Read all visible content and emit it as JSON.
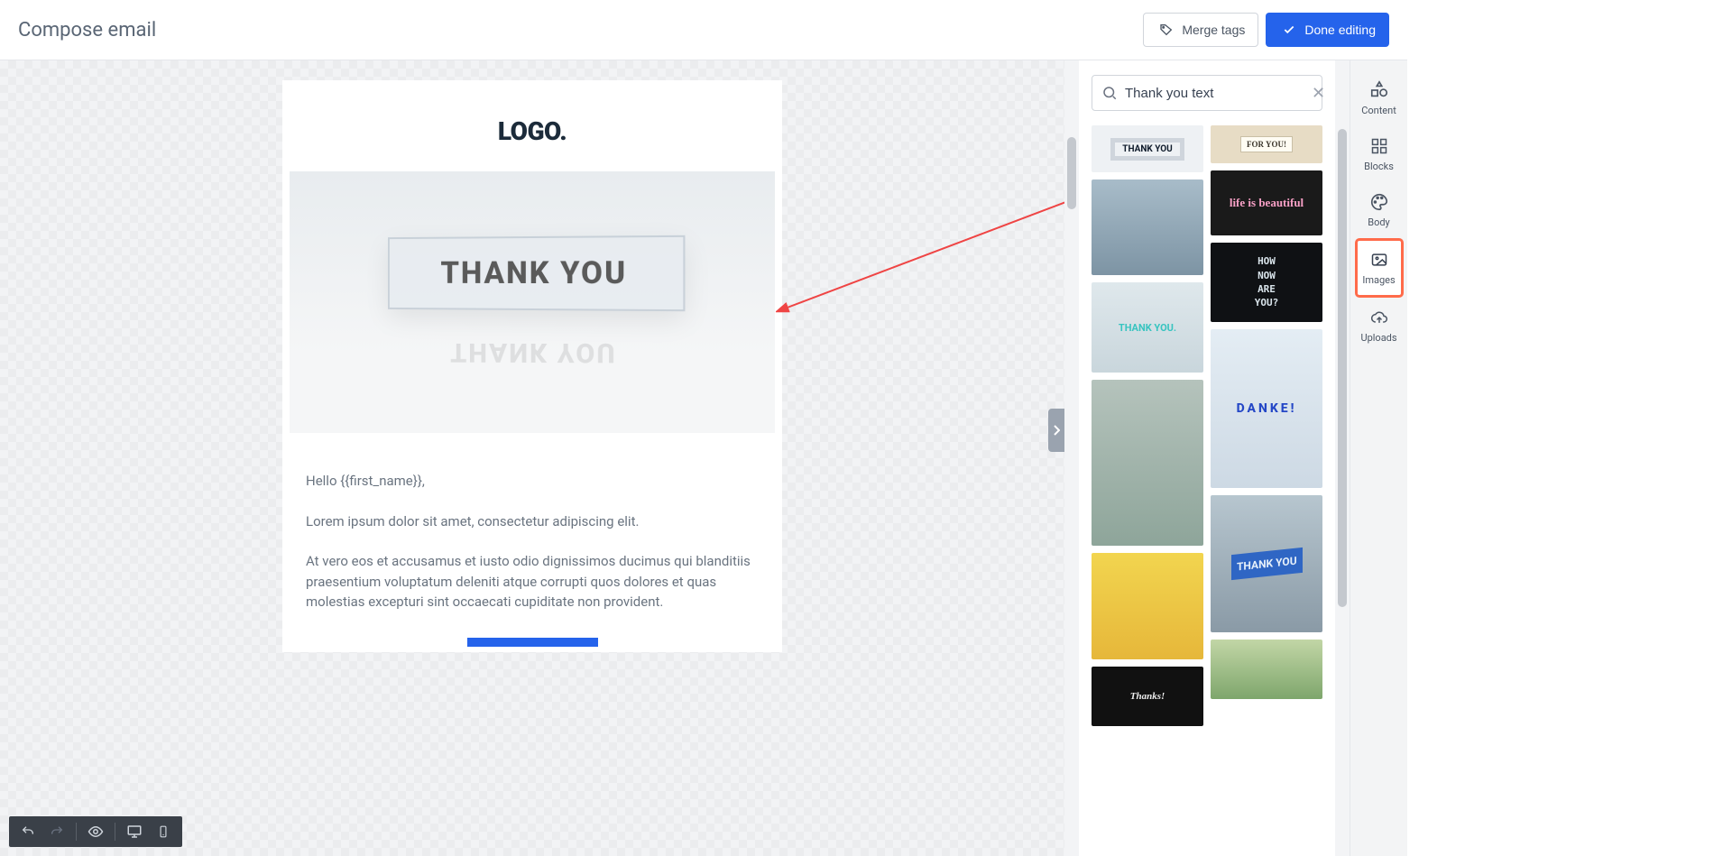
{
  "header": {
    "title": "Compose email",
    "merge_tags": "Merge tags",
    "done_editing": "Done editing"
  },
  "email": {
    "logo": "LOGO.",
    "hero_text": "THANK YOU",
    "greeting": "Hello {{first_name}},",
    "para1": "Lorem ipsum dolor sit amet, consectetur adipiscing elit.",
    "para2": "At vero eos et accusamus et iusto odio dignissimos ducimus qui blanditiis praesentium voluptatum deleniti atque corrupti quos dolores et quas molestias excepturi sint occaecati cupiditate non provident."
  },
  "search": {
    "value": "Thank you text"
  },
  "thumbs": {
    "l1": "THANK YOU",
    "l3": "THANK YOU.",
    "l6": "Thanks!",
    "r1": "FOR YOU!",
    "r2": "life is beautiful",
    "r3_1": "HOW",
    "r3_2": "NOW",
    "r3_3": "ARE",
    "r3_4": "YOU?",
    "r4": "DANKE!",
    "r5": "THANK YOU"
  },
  "sidebar": {
    "content": "Content",
    "blocks": "Blocks",
    "body": "Body",
    "images": "Images",
    "uploads": "Uploads"
  }
}
